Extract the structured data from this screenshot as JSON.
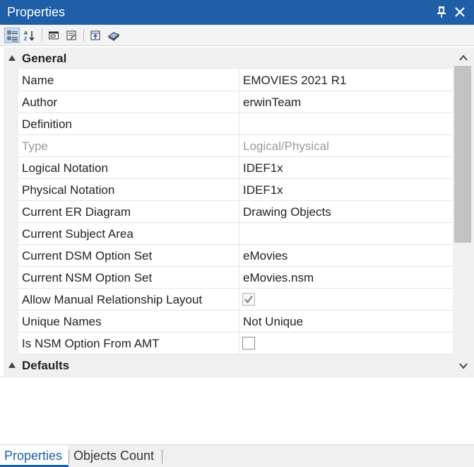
{
  "panel": {
    "title": "Properties",
    "pin_glyph": "🡥",
    "close_glyph": "✕"
  },
  "toolbar": {
    "icons": [
      "categorized-icon",
      "alphabetical-icon",
      "object-icon",
      "property-pages-icon",
      "export-icon",
      "book-icon"
    ]
  },
  "grid": {
    "categories": [
      {
        "label": "General",
        "expanded": true
      },
      {
        "label": "Defaults",
        "expanded": true
      }
    ],
    "rows": [
      {
        "name": "Name",
        "value": "EMOVIES 2021 R1"
      },
      {
        "name": "Author",
        "value": "erwinTeam"
      },
      {
        "name": "Definition",
        "value": ""
      },
      {
        "name": "Type",
        "value": "Logical/Physical",
        "disabled": true
      },
      {
        "name": "Logical Notation",
        "value": "IDEF1x"
      },
      {
        "name": "Physical Notation",
        "value": "IDEF1x"
      },
      {
        "name": "Current ER Diagram",
        "value": "Drawing Objects"
      },
      {
        "name": "Current Subject Area",
        "value": ""
      },
      {
        "name": "Current DSM Option Set",
        "value": "eMovies"
      },
      {
        "name": "Current NSM Option Set",
        "value": "eMovies.nsm"
      },
      {
        "name": "Allow Manual Relationship Layout",
        "value": "",
        "checkbox": true,
        "checked": true
      },
      {
        "name": "Unique Names",
        "value": "Not Unique"
      },
      {
        "name": "Is NSM Option From AMT",
        "value": "",
        "checkbox": true,
        "checked": false
      }
    ]
  },
  "tabs": [
    {
      "label": "Properties",
      "active": true
    },
    {
      "label": "Objects Count",
      "active": false
    }
  ],
  "colors": {
    "accent": "#1f5fa8",
    "category_bg": "#f0f0f0",
    "disabled_text": "#9a9a9a"
  }
}
